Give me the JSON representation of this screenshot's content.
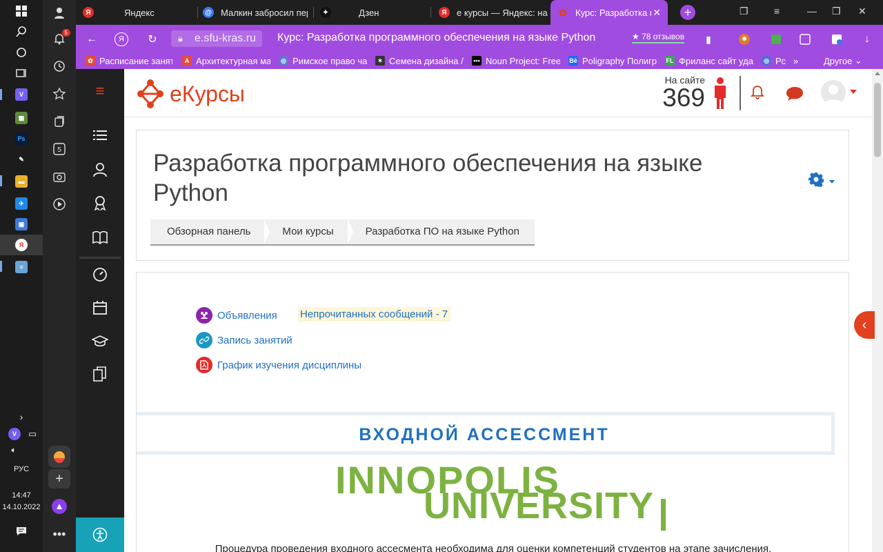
{
  "taskbar": {
    "lang": "РУС",
    "time": "14:47",
    "date": "14.10.2022"
  },
  "browser_panel": {
    "notifications_count": "5",
    "tabs_count": "5"
  },
  "tabs": [
    {
      "title": "Яндекс",
      "favicon": "yandex-icon",
      "color": "#e52b2b"
    },
    {
      "title": "Малкин забросил пер",
      "favicon": "mail-icon",
      "color": "#3b78e7"
    },
    {
      "title": "Дзен",
      "favicon": "zen-icon",
      "color": "#111111"
    },
    {
      "title": "е курсы — Яндекс: на",
      "favicon": "yandex-icon",
      "color": "#e52b2b"
    },
    {
      "title": "Курс: Разработка п",
      "favicon": "ekursy-icon",
      "color": "#e0401c",
      "active": true
    }
  ],
  "address": {
    "domain": "e.sfu-kras.ru",
    "page_title": "Курс: Разработка программного обеспечения на языке Python",
    "reviews": "78 отзывов"
  },
  "bookmarks": [
    {
      "label": "Расписание занят",
      "color": "#e84a3a"
    },
    {
      "label": "Архитектурная ма",
      "color": "#e84a3a"
    },
    {
      "label": "Римское право ча",
      "color": "#5a7ec9"
    },
    {
      "label": "Семена дизайна /",
      "color": "#333333"
    },
    {
      "label": "Noun Project: Free",
      "color": "#000000"
    },
    {
      "label": "Poligraphy Полигр",
      "color": "#1769ff"
    },
    {
      "label": "Фриланс сайт уда",
      "color": "#3aa55a"
    },
    {
      "label": "Pc",
      "color": "#4a6fd8"
    }
  ],
  "bookmarks_other": "Другое",
  "header": {
    "logo_text": "еКурсы",
    "online_label": "На сайте",
    "online_count": "369"
  },
  "course": {
    "title": "Разработка программного обеспечения на языке Python",
    "breadcrumb": [
      "Обзорная панель",
      "Мои курсы",
      "Разработка ПО на языке Python"
    ]
  },
  "activities": {
    "announcements": "Объявления",
    "unread": "Непрочитанных сообщений - 7",
    "recording": "Запись занятий",
    "schedule": "График изучения дисциплины"
  },
  "assessment": {
    "title": "ВХОДНОЙ АССЕССМЕНТ",
    "logo_line1": "INNOPOLIS",
    "logo_line2": "UNIVERSITY",
    "procedure": "Процедура проведения входного ассесмента необходима для оценки компетенций студентов на этапе зачисления."
  },
  "colors": {
    "accent_purple": "#a14ce0",
    "brand_red": "#e0401c",
    "link_blue": "#1f70c1",
    "innopolis_green": "#7db241"
  }
}
